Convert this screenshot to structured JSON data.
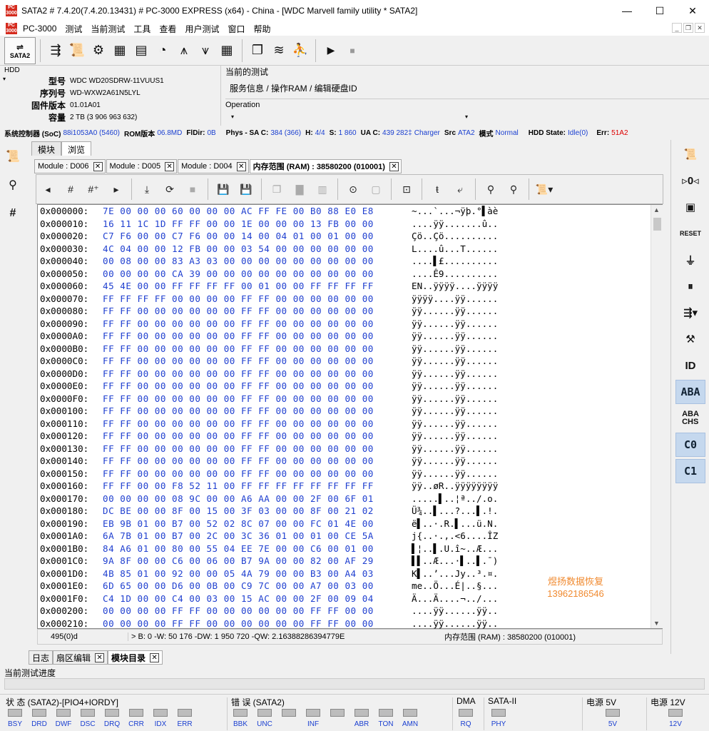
{
  "window": {
    "title": "SATA2 # 7.4.20(7.4.20.13431) # PC-3000 EXPRESS (x64) - China - [WDC Marvell family utility * SATA2]",
    "app_icon_text": "PC 3000",
    "minimize": "—",
    "maximize": "☐",
    "close": "✕"
  },
  "menu": [
    "PC-3000",
    "测试",
    "当前测试",
    "工具",
    "查看",
    "用户测试",
    "窗口",
    "帮助"
  ],
  "toolbar": {
    "sata2_label": "SATA2"
  },
  "hdd": {
    "group_label": "HDD",
    "model_label": "型号",
    "model": "WDC WD20SDRW-11VUUS1",
    "serial_label": "序列号",
    "serial": "WD-WXW2A61N5LYL",
    "firmware_label": "固件版本",
    "firmware": "01.01A01",
    "capacity_label": "容量",
    "capacity": "2 TB (3 906 963 632)"
  },
  "current_test": {
    "label": "当前的测试",
    "path": "服务信息 / 操作RAM / 编辑硬盘ID",
    "operation_label": "Operation"
  },
  "status": {
    "soc_label": "系统控制器 (SoC)",
    "soc": "88i1053A0 (5460)",
    "rom_label": "ROM版本",
    "rom": "06.8MD",
    "fldir_label": "FlDir:",
    "fldir": "0B",
    "physsa_label": "Phys - SA C:",
    "physsa": "384 (366)",
    "h_label": "H:",
    "h": "4/4",
    "s_label": "S:",
    "s": "1 860",
    "uac_label": "UA C:",
    "uac": "439 282‡",
    "charger_label": "Charger",
    "src_label": "Src",
    "src": "ATA2",
    "mode_label": "模式",
    "mode": "Normal",
    "hddstate_label": "HDD State:",
    "hddstate": "Idle(0)",
    "err_label": "Err:",
    "err": "51A2"
  },
  "top_tabs": [
    "模块",
    "浏览"
  ],
  "module_tabs": [
    "Module : D006",
    "Module : D005",
    "Module : D004",
    "内存范围 (RAM) : 38580200 (010001)"
  ],
  "hex_rows": [
    {
      "off": "0x000000:",
      "hex": "7E 00 00 00 60 00 00 00 AC FF FE 00 B0 88 E0 E8",
      "asc": "~...`...¬ÿþ.°▌àè"
    },
    {
      "off": "0x000010:",
      "hex": "16 11 1C 1D FF FF 00 00 1E 00 00 00 13 FB 00 00",
      "asc": "....ÿÿ.......û.."
    },
    {
      "off": "0x000020:",
      "hex": "C7 F6 00 00 C7 F6 00 00 14 00 04 01 00 01 00 00",
      "asc": "Çö..Çö.........."
    },
    {
      "off": "0x000030:",
      "hex": "4C 04 00 00 12 FB 00 00 03 54 00 00 00 00 00 00",
      "asc": "L....û...T......"
    },
    {
      "off": "0x000040:",
      "hex": "00 08 00 00 83 A3 03 00 00 00 00 00 00 00 00 00",
      "asc": "....▌£.........."
    },
    {
      "off": "0x000050:",
      "hex": "00 00 00 00 CA 39 00 00 00 00 00 00 00 00 00 00",
      "asc": "....Ê9.........."
    },
    {
      "off": "0x000060:",
      "hex": "45 4E 00 00 FF FF FF FF 00 01 00 00 FF FF FF FF",
      "asc": "EN..ÿÿÿÿ....ÿÿÿÿ"
    },
    {
      "off": "0x000070:",
      "hex": "FF FF FF FF 00 00 00 00 FF FF 00 00 00 00 00 00",
      "asc": "ÿÿÿÿ....ÿÿ......"
    },
    {
      "off": "0x000080:",
      "hex": "FF FF 00 00 00 00 00 00 FF FF 00 00 00 00 00 00",
      "asc": "ÿÿ......ÿÿ......"
    },
    {
      "off": "0x000090:",
      "hex": "FF FF 00 00 00 00 00 00 FF FF 00 00 00 00 00 00",
      "asc": "ÿÿ......ÿÿ......"
    },
    {
      "off": "0x0000A0:",
      "hex": "FF FF 00 00 00 00 00 00 FF FF 00 00 00 00 00 00",
      "asc": "ÿÿ......ÿÿ......"
    },
    {
      "off": "0x0000B0:",
      "hex": "FF FF 00 00 00 00 00 00 FF FF 00 00 00 00 00 00",
      "asc": "ÿÿ......ÿÿ......"
    },
    {
      "off": "0x0000C0:",
      "hex": "FF FF 00 00 00 00 00 00 FF FF 00 00 00 00 00 00",
      "asc": "ÿÿ......ÿÿ......"
    },
    {
      "off": "0x0000D0:",
      "hex": "FF FF 00 00 00 00 00 00 FF FF 00 00 00 00 00 00",
      "asc": "ÿÿ......ÿÿ......"
    },
    {
      "off": "0x0000E0:",
      "hex": "FF FF 00 00 00 00 00 00 FF FF 00 00 00 00 00 00",
      "asc": "ÿÿ......ÿÿ......"
    },
    {
      "off": "0x0000F0:",
      "hex": "FF FF 00 00 00 00 00 00 FF FF 00 00 00 00 00 00",
      "asc": "ÿÿ......ÿÿ......"
    },
    {
      "off": "0x000100:",
      "hex": "FF FF 00 00 00 00 00 00 FF FF 00 00 00 00 00 00",
      "asc": "ÿÿ......ÿÿ......"
    },
    {
      "off": "0x000110:",
      "hex": "FF FF 00 00 00 00 00 00 FF FF 00 00 00 00 00 00",
      "asc": "ÿÿ......ÿÿ......"
    },
    {
      "off": "0x000120:",
      "hex": "FF FF 00 00 00 00 00 00 FF FF 00 00 00 00 00 00",
      "asc": "ÿÿ......ÿÿ......"
    },
    {
      "off": "0x000130:",
      "hex": "FF FF 00 00 00 00 00 00 FF FF 00 00 00 00 00 00",
      "asc": "ÿÿ......ÿÿ......"
    },
    {
      "off": "0x000140:",
      "hex": "FF FF 00 00 00 00 00 00 FF FF 00 00 00 00 00 00",
      "asc": "ÿÿ......ÿÿ......"
    },
    {
      "off": "0x000150:",
      "hex": "FF FF 00 00 00 00 00 00 FF FF 00 00 00 00 00 00",
      "asc": "ÿÿ......ÿÿ......"
    },
    {
      "off": "0x000160:",
      "hex": "FF FF 00 00 F8 52 11 00 FF FF FF FF FF FF FF FF",
      "asc": "ÿÿ..øR..ÿÿÿÿÿÿÿÿ"
    },
    {
      "off": "0x000170:",
      "hex": "00 00 00 00 08 9C 00 00 A6 AA 00 00 2F 00 6F 01",
      "asc": ".....▌..¦ª../.o."
    },
    {
      "off": "0x000180:",
      "hex": "DC BE 00 00 8F 00 15 00 3F 03 00 00 8F 00 21 02",
      "asc": "Ü¾..▌...?...▌.!."
    },
    {
      "off": "0x000190:",
      "hex": "EB 9B 01 00 B7 00 52 02 8C 07 00 00 FC 01 4E 00",
      "asc": "ë▌..·.R.▌...ü.N."
    },
    {
      "off": "0x0001A0:",
      "hex": "6A 7B 01 00 B7 00 2C 00 3C 36 01 00 01 00 CE 5A",
      "asc": "j{..·.,.<6....ÎZ"
    },
    {
      "off": "0x0001B0:",
      "hex": "84 A6 01 00 80 00 55 04 EE 7E 00 00 C6 00 01 00",
      "asc": "▌¦..▌.U.î~..Æ..."
    },
    {
      "off": "0x0001C0:",
      "hex": "9A 8F 00 00 C6 00 06 00 B7 9A 00 00 82 00 AF 29",
      "asc": "▌▌..Æ...·▌..▌.¯)"
    },
    {
      "off": "0x0001D0:",
      "hex": "4B 85 01 00 92 00 00 05 4A 79 00 00 B3 00 A4 03",
      "asc": "K▌..’...Jy..³.¤."
    },
    {
      "off": "0x0001E0:",
      "hex": "6D 65 00 00 D6 00 0B 00 C9 7C 00 00 A7 00 03 00",
      "asc": "me..Ö...É|..§..."
    },
    {
      "off": "0x0001F0:",
      "hex": "C4 1D 00 00 C4 00 03 00 15 AC 00 00 2F 00 09 04",
      "asc": "Ä...Ä....¬../..."
    },
    {
      "off": "0x000200:",
      "hex": "00 00 00 00 FF FF 00 00 00 00 00 00 FF FF 00 00",
      "asc": "....ÿÿ......ÿÿ.."
    },
    {
      "off": "0x000210:",
      "hex": "00 00 00 00 FF FF 00 00 00 00 00 00 FF FF 00 00",
      "asc": "....ÿÿ......ÿÿ.."
    }
  ],
  "watermark": {
    "line1": "煜扬数据恢复",
    "line2": "13962186546"
  },
  "hex_status": {
    "pos": "495(0)d",
    "info": "> B: 0 -W: 50 176 -DW: 1 950 720 -QW: 2.16388286394779E",
    "range": "内存范围 (RAM) : 38580200 (010001)"
  },
  "bottom_tabs": [
    "日志",
    "扇区编辑",
    "模块目录"
  ],
  "progress_label": "当前测试进度",
  "state_groups": {
    "state_label": "状 态 (SATA2)-[PIO4+IORDY]",
    "state_leds": [
      "BSY",
      "DRD",
      "DWF",
      "DSC",
      "DRQ",
      "CRR",
      "IDX",
      "ERR"
    ],
    "error_label": "错 误 (SATA2)",
    "error_leds": [
      "BBK",
      "UNC",
      "",
      "INF",
      "",
      "ABR",
      "TON",
      "AMN"
    ],
    "dma_label": "DMA",
    "dma_leds": [
      "RQ"
    ],
    "sata_label": "SATA-II",
    "sata_leds": [
      "PHY"
    ],
    "p5_label": "电源 5V",
    "p5_leds": [
      "5V"
    ],
    "p12_label": "电源 12V",
    "p12_leds": [
      "12V"
    ]
  }
}
